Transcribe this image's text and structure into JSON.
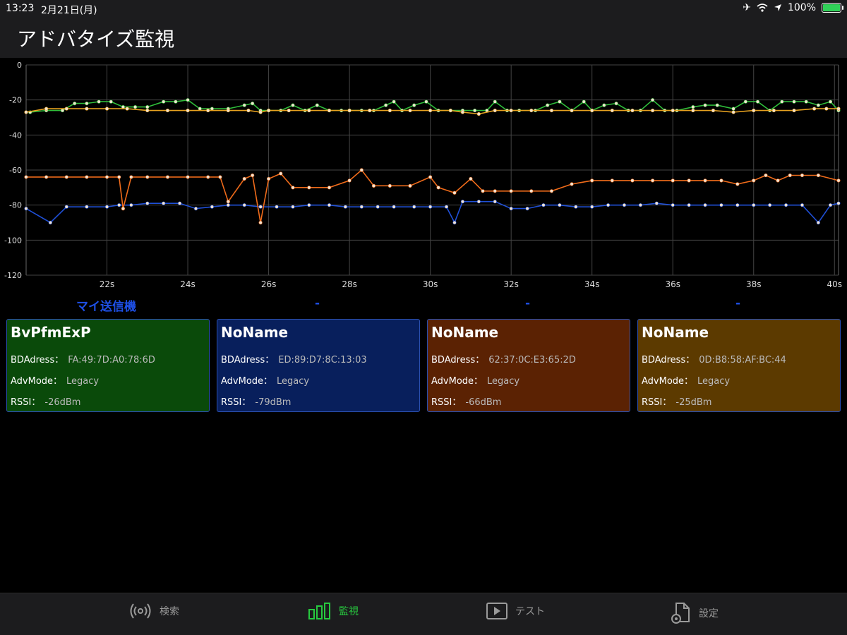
{
  "status": {
    "time": "13:23",
    "date": "2月21日(月)",
    "battery": "100%"
  },
  "header": {
    "title": "アドバタイズ監視"
  },
  "chart_data": {
    "type": "line",
    "ylim": [
      -120,
      0
    ],
    "y_ticks": [
      "0",
      "-20",
      "-40",
      "-60",
      "-80",
      "-100",
      "-120"
    ],
    "x_ticks": [
      "22s",
      "24s",
      "26s",
      "28s",
      "30s",
      "32s",
      "34s",
      "36s",
      "38s",
      "40s"
    ],
    "grid": true,
    "series": [
      {
        "name": "BvPfmExP",
        "color": "#2fbe3a",
        "x": [
          20.1,
          20.5,
          20.9,
          21.2,
          21.5,
          21.8,
          22.1,
          22.4,
          22.7,
          23.0,
          23.4,
          23.7,
          24.0,
          24.3,
          24.6,
          25.0,
          25.4,
          25.6,
          25.8,
          26.0,
          26.3,
          26.6,
          26.9,
          27.2,
          27.5,
          27.8,
          28.0,
          28.3,
          28.6,
          28.9,
          29.1,
          29.3,
          29.6,
          29.9,
          30.2,
          30.5,
          30.8,
          31.1,
          31.4,
          31.6,
          31.9,
          32.2,
          32.6,
          32.9,
          33.2,
          33.5,
          33.8,
          34.0,
          34.3,
          34.6,
          34.9,
          35.2,
          35.5,
          35.8,
          36.1,
          36.5,
          36.8,
          37.1,
          37.5,
          37.8,
          38.1,
          38.4,
          38.7,
          39.0,
          39.3,
          39.6,
          39.9,
          40.1
        ],
        "y": [
          -27,
          -26,
          -26,
          -22,
          -22,
          -21,
          -21,
          -24,
          -24,
          -24,
          -21,
          -21,
          -20,
          -25,
          -25,
          -25,
          -23,
          -22,
          -26,
          -26,
          -26,
          -23,
          -26,
          -23,
          -26,
          -26,
          -26,
          -26,
          -26,
          -23,
          -21,
          -26,
          -23,
          -21,
          -26,
          -26,
          -26,
          -26,
          -26,
          -21,
          -26,
          -26,
          -26,
          -23,
          -21,
          -26,
          -21,
          -26,
          -23,
          -22,
          -26,
          -26,
          -20,
          -26,
          -26,
          -24,
          -23,
          -23,
          -25,
          -21,
          -21,
          -26,
          -21,
          -21,
          -21,
          -23,
          -21,
          -26
        ]
      },
      {
        "name": "NoName",
        "color": "#1f4fd6",
        "x": [
          20.0,
          20.6,
          21.0,
          21.5,
          22.0,
          22.3,
          22.6,
          23.0,
          23.4,
          23.8,
          24.2,
          24.6,
          25.0,
          25.4,
          25.8,
          26.2,
          26.6,
          27.0,
          27.5,
          27.9,
          28.3,
          28.7,
          29.1,
          29.6,
          30.0,
          30.4,
          30.6,
          30.8,
          31.2,
          31.6,
          32.0,
          32.4,
          32.8,
          33.2,
          33.6,
          34.0,
          34.4,
          34.8,
          35.2,
          35.6,
          36.0,
          36.4,
          36.8,
          37.2,
          37.6,
          38.0,
          38.4,
          38.8,
          39.2,
          39.6,
          39.9,
          40.1
        ],
        "y": [
          -82,
          -90,
          -81,
          -81,
          -81,
          -80,
          -80,
          -79,
          -79,
          -79,
          -82,
          -81,
          -80,
          -80,
          -81,
          -81,
          -81,
          -80,
          -80,
          -81,
          -81,
          -81,
          -81,
          -81,
          -81,
          -81,
          -90,
          -78,
          -78,
          -78,
          -82,
          -82,
          -80,
          -80,
          -81,
          -81,
          -80,
          -80,
          -80,
          -79,
          -80,
          -80,
          -80,
          -80,
          -80,
          -80,
          -80,
          -80,
          -80,
          -90,
          -80,
          -79
        ]
      },
      {
        "name": "NoName",
        "color": "#f06b1a",
        "x": [
          20.0,
          20.5,
          21.0,
          21.5,
          22.0,
          22.3,
          22.4,
          22.6,
          23.0,
          23.5,
          24.0,
          24.5,
          24.8,
          25.0,
          25.4,
          25.6,
          25.8,
          26.0,
          26.3,
          26.6,
          27.0,
          27.5,
          28.0,
          28.3,
          28.6,
          29.0,
          29.5,
          30.0,
          30.2,
          30.6,
          31.0,
          31.3,
          31.6,
          32.0,
          32.5,
          33.0,
          33.5,
          34.0,
          34.5,
          35.0,
          35.5,
          36.0,
          36.4,
          36.8,
          37.2,
          37.6,
          38.0,
          38.3,
          38.6,
          38.9,
          39.2,
          39.6,
          40.1
        ],
        "y": [
          -64,
          -64,
          -64,
          -64,
          -64,
          -64,
          -82,
          -64,
          -64,
          -64,
          -64,
          -64,
          -64,
          -78,
          -65,
          -63,
          -90,
          -65,
          -62,
          -70,
          -70,
          -70,
          -66,
          -60,
          -69,
          -69,
          -69,
          -64,
          -70,
          -73,
          -65,
          -72,
          -72,
          -72,
          -72,
          -72,
          -68,
          -66,
          -66,
          -66,
          -66,
          -66,
          -66,
          -66,
          -66,
          -68,
          -66,
          -63,
          -66,
          -63,
          -63,
          -63,
          -66
        ]
      },
      {
        "name": "NoName",
        "color": "#e8a21f",
        "x": [
          20.0,
          20.5,
          21.0,
          21.5,
          22.0,
          22.5,
          23.0,
          23.5,
          24.0,
          24.5,
          25.0,
          25.5,
          25.8,
          26.0,
          26.5,
          27.0,
          27.5,
          28.0,
          28.5,
          29.0,
          29.5,
          30.0,
          30.5,
          30.8,
          31.2,
          31.6,
          32.0,
          32.5,
          33.0,
          33.5,
          34.0,
          34.5,
          35.0,
          35.5,
          36.0,
          36.5,
          37.0,
          37.5,
          38.0,
          38.5,
          39.0,
          39.5,
          39.8,
          40.1
        ],
        "y": [
          -27,
          -25,
          -25,
          -25,
          -25,
          -25,
          -26,
          -26,
          -26,
          -26,
          -26,
          -26,
          -27,
          -26,
          -26,
          -26,
          -26,
          -26,
          -26,
          -26,
          -26,
          -26,
          -26,
          -27,
          -28,
          -26,
          -26,
          -26,
          -26,
          -26,
          -26,
          -26,
          -26,
          -26,
          -26,
          -26,
          -26,
          -27,
          -26,
          -26,
          -26,
          -25,
          -25,
          -25
        ]
      }
    ]
  },
  "legend": {
    "label": "マイ送信機",
    "other": [
      "-",
      "-",
      "-"
    ]
  },
  "cards": [
    {
      "name": "BvPfmExP",
      "bd_label": "BDAdress：",
      "bd": "FA:49:7D:A0:78:6D",
      "mode_label": "AdvMode：",
      "mode": "Legacy",
      "rssi_label": "RSSI：",
      "rssi": "-26dBm",
      "bg": "#0a4a0a"
    },
    {
      "name": "NoName",
      "bd_label": "BDAdress：",
      "bd": "ED:89:D7:8C:13:03",
      "mode_label": "AdvMode：",
      "mode": "Legacy",
      "rssi_label": "RSSI：",
      "rssi": "-79dBm",
      "bg": "#081f5c"
    },
    {
      "name": "NoName",
      "bd_label": "BDAdress：",
      "bd": "62:37:0C:E3:65:2D",
      "mode_label": "AdvMode：",
      "mode": "Legacy",
      "rssi_label": "RSSI：",
      "rssi": "-66dBm",
      "bg": "#5b2203"
    },
    {
      "name": "NoName",
      "bd_label": "BDAdress：",
      "bd": "0D:B8:58:AF:BC:44",
      "mode_label": "AdvMode：",
      "mode": "Legacy",
      "rssi_label": "RSSI：",
      "rssi": "-25dBm",
      "bg": "#5c3a00"
    }
  ],
  "tabs": [
    {
      "label": "検索",
      "icon": "broadcast-icon",
      "active": false
    },
    {
      "label": "監視",
      "icon": "bars-icon",
      "active": true
    },
    {
      "label": "テスト",
      "icon": "play-icon",
      "active": false
    },
    {
      "label": "設定",
      "icon": "settings-doc-icon",
      "active": false
    }
  ]
}
